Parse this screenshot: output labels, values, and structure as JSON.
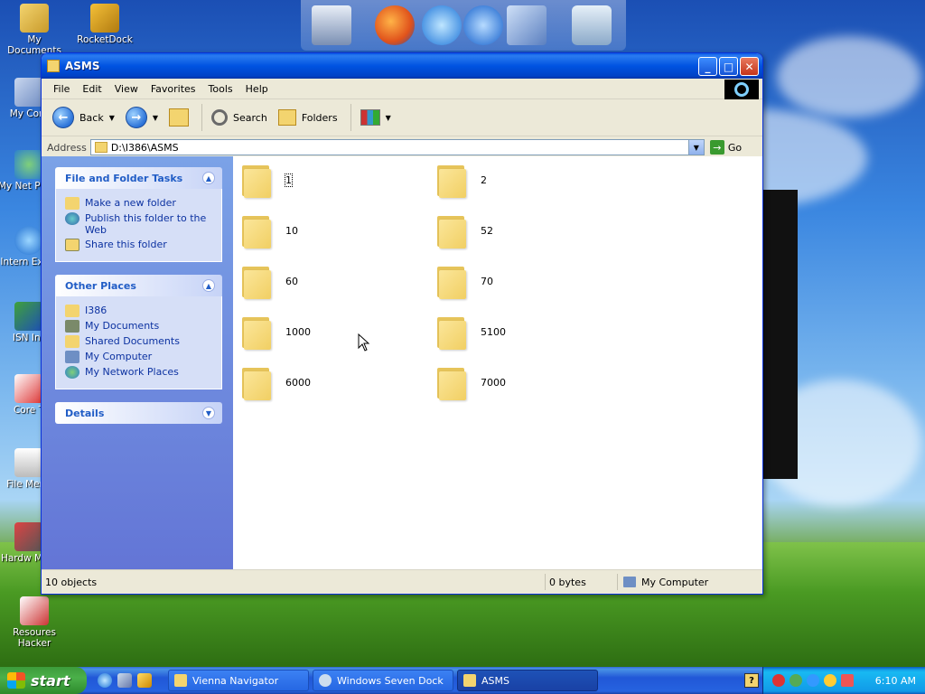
{
  "desktop": {
    "icons": [
      {
        "label": "My Documents"
      },
      {
        "label": "RocketDock"
      },
      {
        "label": "My Com"
      },
      {
        "label": "My Net Place"
      },
      {
        "label": "Intern Explo"
      },
      {
        "label": "ISN Ins"
      },
      {
        "label": "Core T"
      },
      {
        "label": "File Menu"
      },
      {
        "label": "Hardw Moni"
      },
      {
        "label": "Resoures Hacker"
      }
    ],
    "dock_icons": [
      "monitor-icon",
      "firefox-icon",
      "ie-icon",
      "media-player-icon",
      "settings-icon",
      "recycle-bin-icon"
    ]
  },
  "window": {
    "title": "ASMS",
    "menu": [
      "File",
      "Edit",
      "View",
      "Favorites",
      "Tools",
      "Help"
    ],
    "toolbar": {
      "back_label": "Back",
      "search_label": "Search",
      "folders_label": "Folders"
    },
    "address": {
      "label": "Address",
      "value": "D:\\I386\\ASMS",
      "go_label": "Go"
    },
    "tasks_panel": {
      "title": "File and Folder Tasks",
      "items": [
        "Make a new folder",
        "Publish this folder to the Web",
        "Share this folder"
      ]
    },
    "places_panel": {
      "title": "Other Places",
      "items": [
        "I386",
        "My Documents",
        "Shared Documents",
        "My Computer",
        "My Network Places"
      ]
    },
    "details_panel": {
      "title": "Details"
    },
    "files": [
      "1",
      "2",
      "10",
      "52",
      "60",
      "70",
      "1000",
      "5100",
      "6000",
      "7000"
    ],
    "status": {
      "objects": "10 objects",
      "size": "0 bytes",
      "location": "My Computer"
    }
  },
  "taskbar": {
    "start_label": "start",
    "tasks": [
      {
        "label": "Vienna Navigator"
      },
      {
        "label": "Windows Seven Dock"
      },
      {
        "label": "ASMS"
      }
    ],
    "clock": "6:10 AM"
  },
  "colors": {
    "title_blue": "#0053e1",
    "task_link": "#0c32a1",
    "panel_head_text": "#215dc6",
    "start_green": "#3c9b3b"
  }
}
